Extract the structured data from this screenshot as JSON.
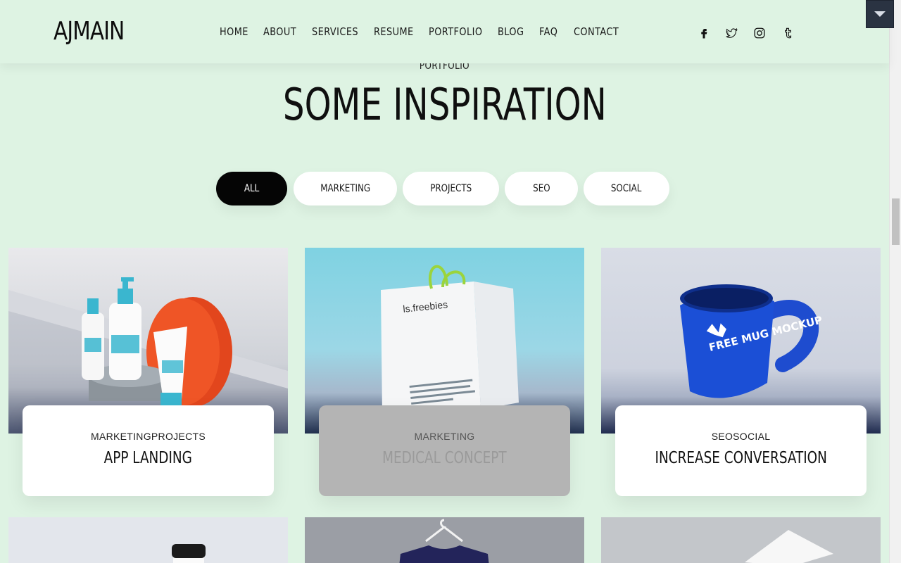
{
  "header": {
    "logo": "AJMAIN",
    "nav": [
      "HOME",
      "ABOUT",
      "SERVICES",
      "RESUME",
      "PORTFOLIO",
      "BLOG",
      "FAQ",
      "CONTACT"
    ],
    "social_icons": [
      "facebook-icon",
      "twitter-icon",
      "instagram-icon",
      "tumblr-icon"
    ]
  },
  "section": {
    "eyebrow": "PORTFOLIO",
    "title": "SOME INSPIRATION"
  },
  "filters": [
    {
      "label": "ALL",
      "active": true
    },
    {
      "label": "MARKETING",
      "active": false
    },
    {
      "label": "PROJECTS",
      "active": false
    },
    {
      "label": "SEO",
      "active": false
    },
    {
      "label": "SOCIAL",
      "active": false
    }
  ],
  "portfolio": [
    {
      "categories": "MARKETINGPROJECTS",
      "title": "APP LANDING",
      "image": "cosmetic-mockup"
    },
    {
      "categories": "MARKETING",
      "title": "MEDICAL CONCEPT",
      "image": "shopping-bag-mockup",
      "image_text": "ls.freebies"
    },
    {
      "categories": "SEOSOCIAL",
      "title": "INCREASE CONVERSATION",
      "image": "mug-mockup",
      "image_text": "FREE MUG MOCKUP"
    }
  ],
  "colors": {
    "background": "#def3e3",
    "accent": "#050505",
    "card": "#ffffff"
  }
}
